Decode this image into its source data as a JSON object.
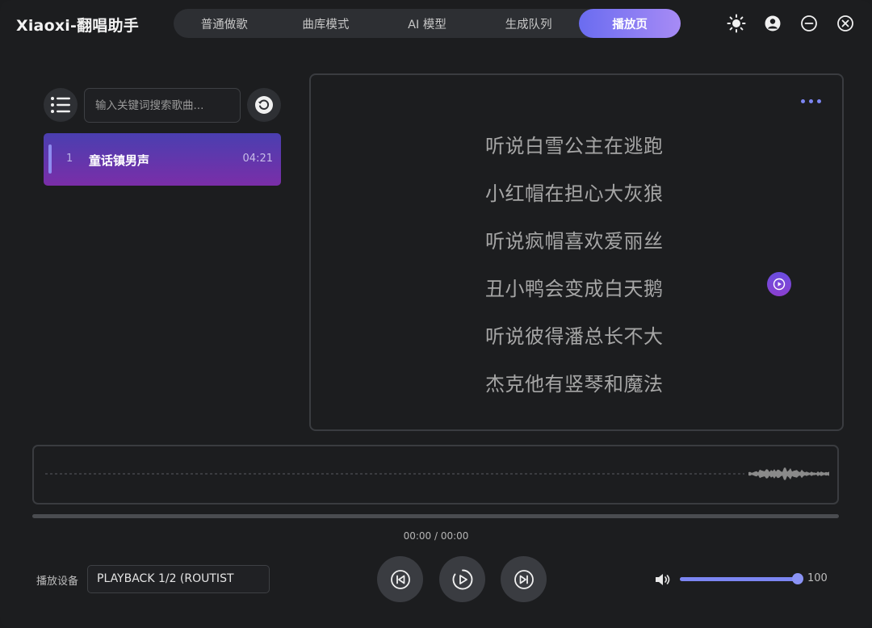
{
  "app": {
    "title": "Xiaoxi-翻唱助手"
  },
  "tabs": [
    {
      "label": "普通做歌",
      "active": false
    },
    {
      "label": "曲库模式",
      "active": false
    },
    {
      "label": "AI 模型",
      "active": false
    },
    {
      "label": "生成队列",
      "active": false
    },
    {
      "label": "播放页",
      "active": true
    }
  ],
  "window_controls": {
    "icons": [
      "sun-icon",
      "user-icon",
      "minimize-icon",
      "close-icon"
    ]
  },
  "playlist": {
    "search_placeholder": "输入关键词搜索歌曲...",
    "items": [
      {
        "index": "1",
        "title": "童话镇男声",
        "duration": "04:21",
        "selected": true
      }
    ]
  },
  "lyrics": {
    "lines": [
      "听说白雪公主在逃跑",
      "小红帽在担心大灰狼",
      "听说疯帽喜欢爱丽丝",
      "丑小鸭会变成白天鹅",
      "听说彼得潘总长不大",
      "杰克他有竖琴和魔法"
    ]
  },
  "player": {
    "time": "00:00 / 00:00",
    "progress": 0,
    "device_label": "播放设备",
    "device_value": "PLAYBACK 1/2 (ROUTIST",
    "volume": 100,
    "volume_label": "100"
  },
  "colors": {
    "accent": "#7c86f2",
    "tab_active_start": "#6a6cf0",
    "tab_active_end": "#a78bf5",
    "selected_item_start": "#4a3fb0",
    "selected_item_end": "#7a2ea8",
    "background": "#1c1d1f"
  }
}
